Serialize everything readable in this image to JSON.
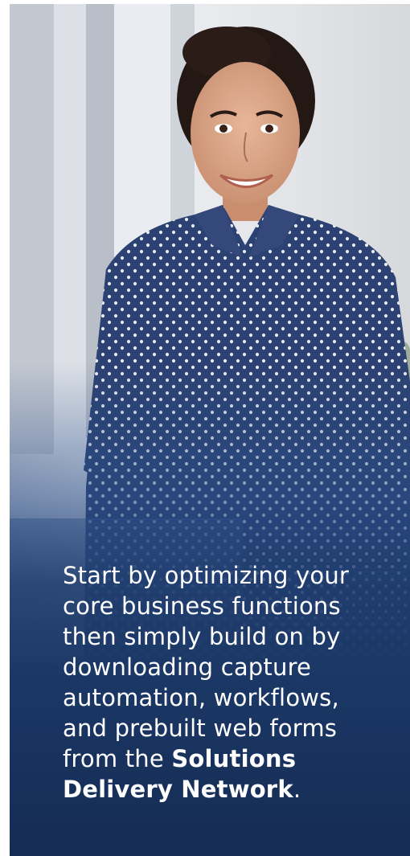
{
  "hero": {
    "caption_pre": "Start by optimizing your core business functions then simply build on by downloading capture automation, workflows, and prebuilt web forms from the ",
    "caption_bold": "Solutions Delivery Network",
    "caption_post": "."
  },
  "colors": {
    "overlay_dark": "#152c54",
    "overlay_mid": "#1b3866",
    "shirt": "#2c4272",
    "background_wall": "#d9dbe0",
    "text": "#ffffff"
  },
  "image": {
    "subject": "smiling-woman-in-polka-dot-shirt-photo"
  }
}
